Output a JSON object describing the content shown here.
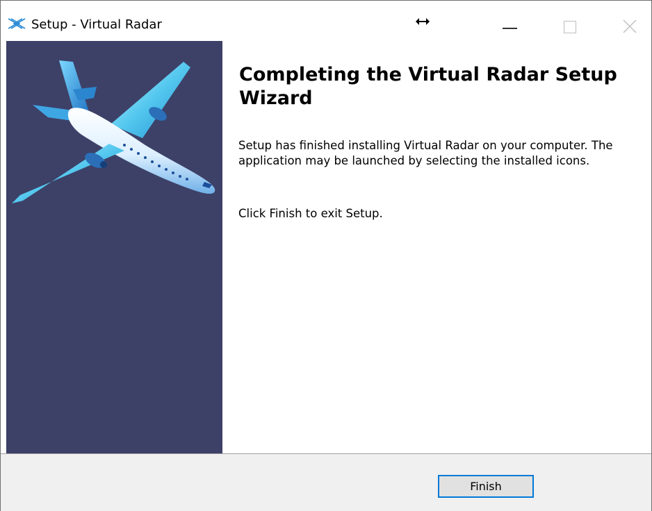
{
  "window": {
    "title": "Setup - Virtual Radar",
    "icon": "virtual-radar-app-icon",
    "controls": [
      "minimize-icon",
      "maximize-icon",
      "close-icon"
    ]
  },
  "side_panel": {
    "image": "airplane-illustration",
    "background_color": "#3d4168"
  },
  "content": {
    "heading": "Completing the Virtual Radar Setup Wizard",
    "paragraph_1": "Setup has finished installing Virtual Radar on your computer. The application may be launched by selecting the installed icons.",
    "paragraph_2": "Click Finish to exit Setup."
  },
  "footer": {
    "finish_label": "Finish"
  },
  "colors": {
    "accent": "#0078d7",
    "footer_bg": "#f0f0f0"
  }
}
